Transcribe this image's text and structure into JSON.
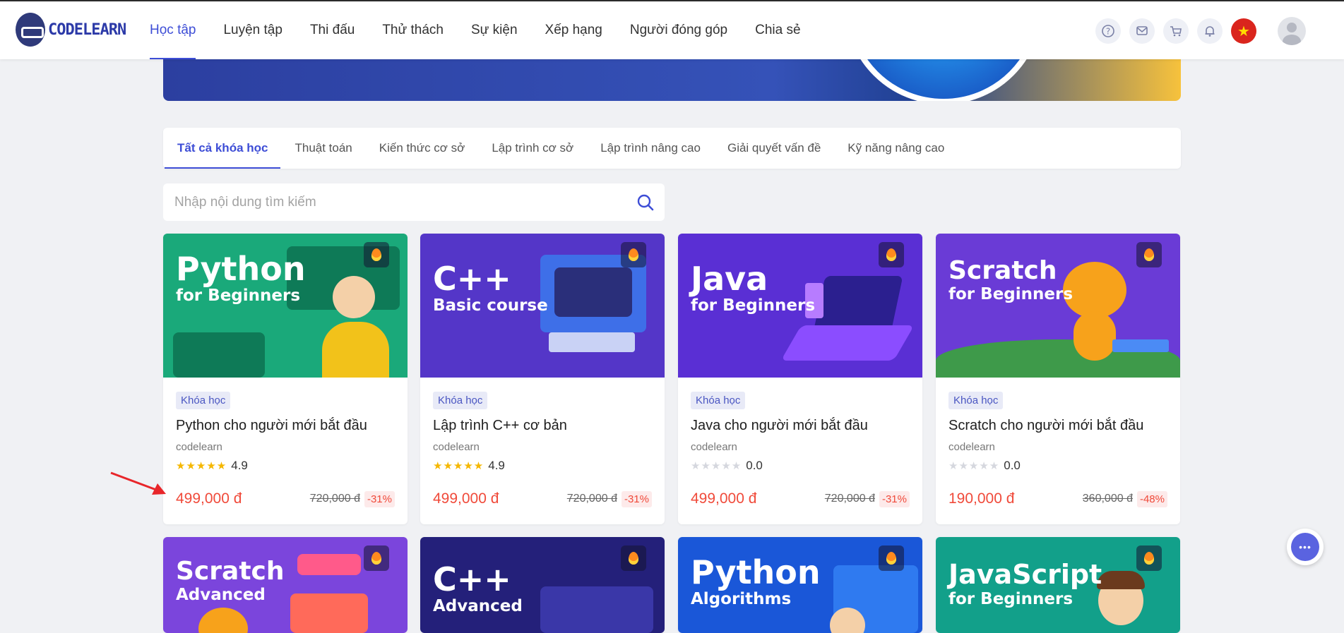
{
  "brand": {
    "name": "CODELEARN"
  },
  "nav": {
    "items": [
      {
        "label": "Học tập",
        "active": true
      },
      {
        "label": "Luyện tập"
      },
      {
        "label": "Thi đấu"
      },
      {
        "label": "Thử thách"
      },
      {
        "label": "Sự kiện"
      },
      {
        "label": "Xếp hạng"
      },
      {
        "label": "Người đóng góp"
      },
      {
        "label": "Chia sẻ"
      }
    ],
    "icons": [
      "help-icon",
      "message-icon",
      "cart-icon",
      "bell-icon",
      "vn-flag-icon",
      "avatar"
    ]
  },
  "tabs": [
    {
      "label": "Tất cả khóa học",
      "active": true
    },
    {
      "label": "Thuật toán"
    },
    {
      "label": "Kiến thức cơ sở"
    },
    {
      "label": "Lập trình cơ sở"
    },
    {
      "label": "Lập trình nâng cao"
    },
    {
      "label": "Giải quyết vấn đề"
    },
    {
      "label": "Kỹ năng nâng cao"
    }
  ],
  "search": {
    "placeholder": "Nhập nội dung tìm kiếm"
  },
  "courses": [
    {
      "thumb_big": "Python",
      "thumb_small": "for Beginners",
      "thumb_color": "#1aa97a",
      "badge": "Khóa học",
      "title": "Python cho người mới bắt đầu",
      "author": "codelearn",
      "stars": "★★★★★",
      "rating": "4.9",
      "rated": true,
      "price": "499,000 đ",
      "old_price": "720,000 đ",
      "discount": "-31%"
    },
    {
      "thumb_big": "C++",
      "thumb_small": "Basic course",
      "thumb_color": "#5436c8",
      "badge": "Khóa học",
      "title": "Lập trình C++ cơ bản",
      "author": "codelearn",
      "stars": "★★★★★",
      "rating": "4.9",
      "rated": true,
      "price": "499,000 đ",
      "old_price": "720,000 đ",
      "discount": "-31%"
    },
    {
      "thumb_big": "Java",
      "thumb_small": "for Beginners",
      "thumb_color": "#5a2fd4",
      "badge": "Khóa học",
      "title": "Java cho người mới bắt đầu",
      "author": "codelearn",
      "stars": "★★★★★",
      "rating": "0.0",
      "rated": false,
      "price": "499,000 đ",
      "old_price": "720,000 đ",
      "discount": "-31%"
    },
    {
      "thumb_big": "Scratch",
      "thumb_small": "for Beginners",
      "thumb_color": "#6a3bd6",
      "badge": "Khóa học",
      "title": "Scratch cho người mới bắt đầu",
      "author": "codelearn",
      "stars": "★★★★★",
      "rating": "0.0",
      "rated": false,
      "price": "190,000 đ",
      "old_price": "360,000 đ",
      "discount": "-48%"
    },
    {
      "thumb_big": "Scratch",
      "thumb_small": "Advanced",
      "thumb_color": "#7b45dc"
    },
    {
      "thumb_big": "C++",
      "thumb_small": "Advanced",
      "thumb_color": "#24207a"
    },
    {
      "thumb_big": "Python",
      "thumb_small": "Algorithms",
      "thumb_color": "#1a57d8"
    },
    {
      "thumb_big": "JavaScript",
      "thumb_small": "for Beginners",
      "thumb_color": "#12a08a"
    }
  ],
  "colors": {
    "accent": "#3d4dd6",
    "price": "#f04a3a",
    "annotation_arrow": "#e8262a"
  }
}
